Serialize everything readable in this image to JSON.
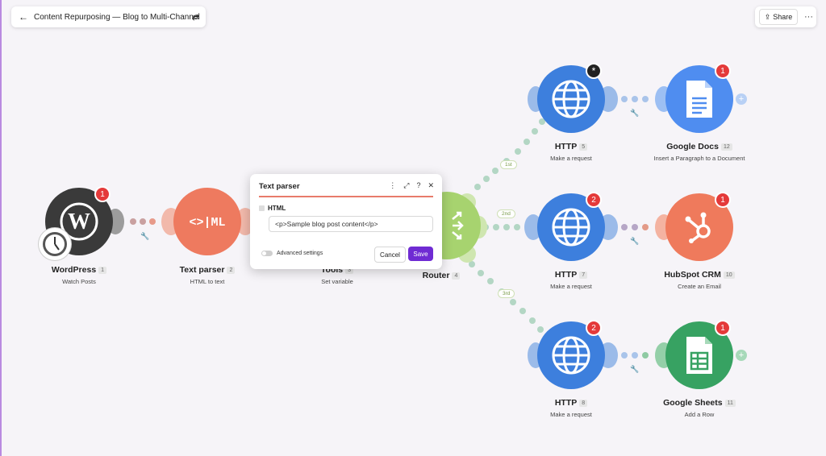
{
  "topbar": {
    "title": "Content Repurposing — Blog to Multi-Channel",
    "back_icon": "arrow-left-icon",
    "settings_icon": "sliders-icon"
  },
  "actions": {
    "share_label": "Share",
    "more_label": "···"
  },
  "nodes": {
    "wordpress": {
      "name": "WordPress",
      "num": "1",
      "sub": "Watch Posts",
      "badge": "1",
      "color": "#3a3a3a"
    },
    "textparser": {
      "name": "Text parser",
      "num": "2",
      "sub": "HTML to text",
      "color": "#ee7a5f"
    },
    "tools": {
      "name": "Tools",
      "num": "3",
      "sub": "Set variable"
    },
    "router": {
      "name": "Router",
      "num": "4",
      "sub": "",
      "color": "#a7d36f"
    },
    "http1": {
      "name": "HTTP",
      "num": "5",
      "sub": "Make a request",
      "badge": "*",
      "color": "#3d7fdd"
    },
    "http2": {
      "name": "HTTP",
      "num": "7",
      "sub": "Make a request",
      "badge": "2"
    },
    "http3": {
      "name": "HTTP",
      "num": "8",
      "sub": "Make a request",
      "badge": "2"
    },
    "gdocs": {
      "name": "Google Docs",
      "num": "12",
      "sub": "Insert a Paragraph to a Document",
      "badge": "1",
      "color": "#4f8df0"
    },
    "hubspot": {
      "name": "HubSpot CRM",
      "num": "10",
      "sub": "Create an Email",
      "badge": "1",
      "color": "#ef7a5c"
    },
    "gsheets": {
      "name": "Google Sheets",
      "num": "11",
      "sub": "Add a Row",
      "badge": "1",
      "color": "#37a262"
    }
  },
  "routes": {
    "r1": "1st",
    "r2": "2nd",
    "r3": "3rd"
  },
  "panel": {
    "title": "Text parser",
    "field_label": "HTML",
    "field_value": "<p>Sample blog post content</p>",
    "advanced_label": "Advanced settings",
    "cancel_label": "Cancel",
    "save_label": "Save"
  }
}
